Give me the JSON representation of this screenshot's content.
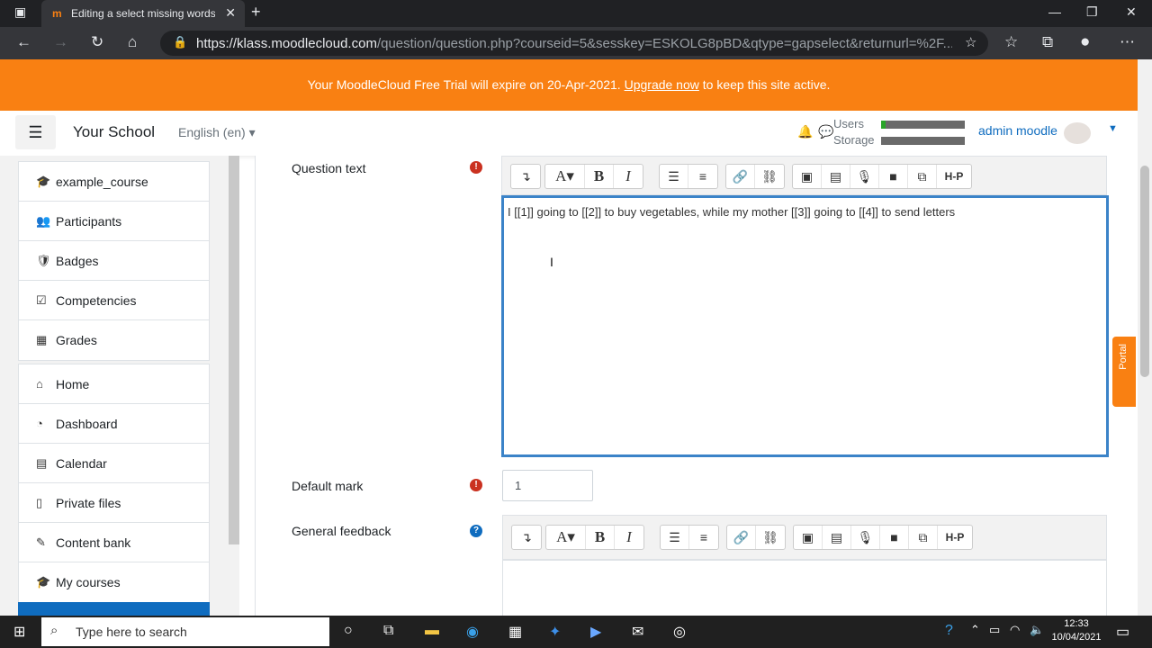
{
  "browser": {
    "tab_title": "Editing a select missing words qu",
    "tab_favicon": "m",
    "url_prefix": "https://",
    "url_host": "klass.moodlecloud.com",
    "url_path": "/question/question.php?courseid=5&sesskey=ESKOLG8pBD&qtype=gapselect&returnurl=%2F..."
  },
  "banner": {
    "prefix": "Your MoodleCloud Free Trial will expire on 20-Apr-2021.",
    "link": "Upgrade now",
    "suffix": "to keep this site active."
  },
  "header": {
    "site_name": "Your School",
    "language": "English (en) ▾",
    "users_label": "Users",
    "storage_label": "Storage",
    "users_fill": 0.05,
    "storage_fill": 0.0,
    "user_name": "admin moodle"
  },
  "drawer": {
    "course_items": [
      {
        "icon": "graduation-cap-icon",
        "glyph": "🎓",
        "label": "example_course"
      },
      {
        "icon": "users-icon",
        "glyph": "👥",
        "label": "Participants"
      },
      {
        "icon": "shield-icon",
        "glyph": "🛡",
        "label": "Badges"
      },
      {
        "icon": "check-square-icon",
        "glyph": "☑",
        "label": "Competencies"
      },
      {
        "icon": "table-icon",
        "glyph": "▦",
        "label": "Grades"
      }
    ],
    "site_items": [
      {
        "icon": "home-icon",
        "glyph": "⌂",
        "label": "Home"
      },
      {
        "icon": "dashboard-icon",
        "glyph": "◔",
        "label": "Dashboard"
      },
      {
        "icon": "calendar-icon",
        "glyph": "▤",
        "label": "Calendar"
      },
      {
        "icon": "file-icon",
        "glyph": "▯",
        "label": "Private files"
      },
      {
        "icon": "brush-icon",
        "glyph": "✎",
        "label": "Content bank"
      },
      {
        "icon": "graduation-cap-icon",
        "glyph": "🎓",
        "label": "My courses"
      }
    ]
  },
  "form": {
    "question_text_label": "Question text",
    "question_text_value": "I [[1]] going to [[2]] to buy vegetables, while my mother [[3]] going to [[4]] to send letters",
    "default_mark_label": "Default mark",
    "default_mark_value": "1",
    "general_feedback_label": "General feedback"
  },
  "portal": {
    "label": "Portal"
  },
  "taskbar": {
    "search_placeholder": "Type here to search",
    "time": "12:33",
    "date": "10/04/2021"
  }
}
